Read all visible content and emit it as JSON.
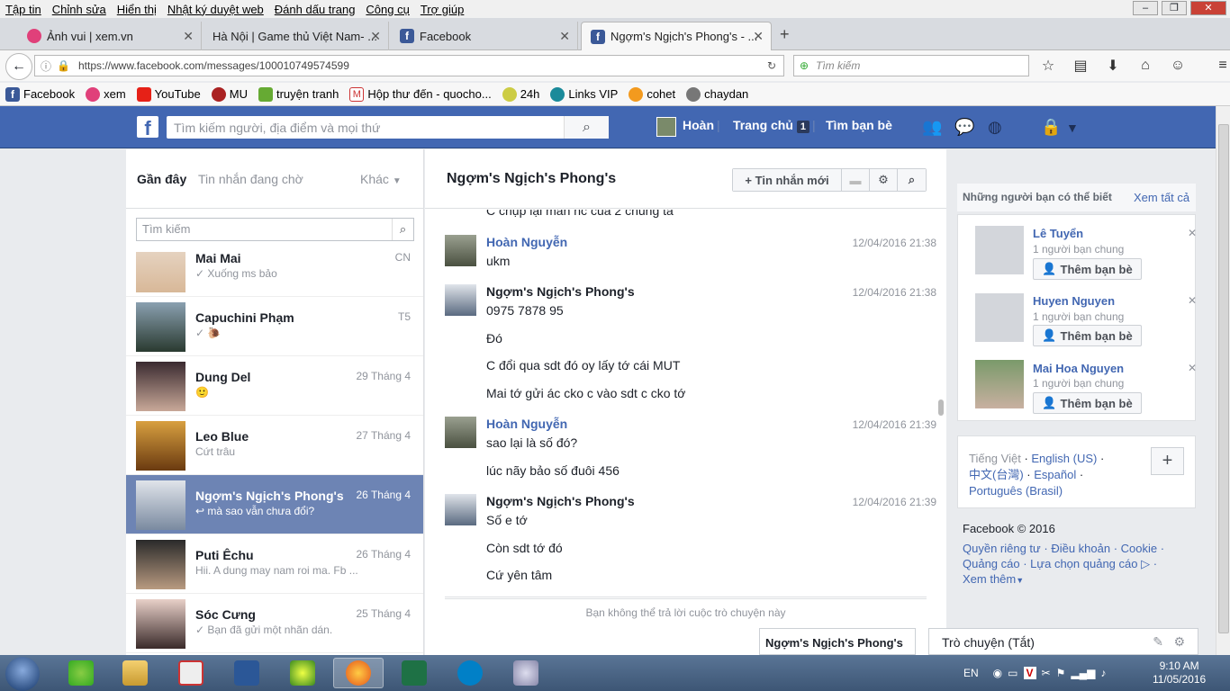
{
  "menu": [
    "Tập tin",
    "Chỉnh sửa",
    "Hiển thị",
    "Nhật ký duyệt web",
    "Đánh dấu trang",
    "Công cụ",
    "Trợ giúp"
  ],
  "tabs": [
    {
      "label": "Ảnh vui | xem.vn"
    },
    {
      "label": "Hà Nội | Game thủ Việt Nam- ..."
    },
    {
      "label": "Facebook"
    },
    {
      "label": "Ngợm's Ngịch's Phong's - ..."
    }
  ],
  "url": "https://www.facebook.com/messages/100010749574599",
  "url_host": "facebook.com",
  "browser_search_placeholder": "Tìm kiếm",
  "bookmarks": [
    "Facebook",
    "xem",
    "YouTube",
    "MU",
    "truyện tranh",
    "Hộp thư đến - quocho...",
    "24h",
    "Links VIP",
    "cohet",
    "chaydan"
  ],
  "fb": {
    "search_placeholder": "Tìm kiếm người, địa điểm và mọi thứ",
    "user": "Hoàn",
    "home": "Trang chủ",
    "home_badge": "1",
    "find_friends": "Tìm bạn bè"
  },
  "left": {
    "tab_recent": "Gần đây",
    "tab_pending": "Tin nhắn đang chờ",
    "tab_other": "Khác",
    "search_placeholder": "Tìm kiếm",
    "conversations": [
      {
        "name": "Mai Mai",
        "date": "CN",
        "preview": "✓ Xuống ms bảo"
      },
      {
        "name": "Capuchini Phạm",
        "date": "T5",
        "preview": "✓ 🐌"
      },
      {
        "name": "Dung Del",
        "date": "29 Tháng 4",
        "preview": "🙂"
      },
      {
        "name": "Leo Blue",
        "date": "27 Tháng 4",
        "preview": "Cứt trâu"
      },
      {
        "name": "Ngợm's Ngịch's Phong's",
        "date": "26 Tháng 4",
        "preview": "↩ mà sao vẫn chưa đổi?"
      },
      {
        "name": "Puti Êchu",
        "date": "26 Tháng 4",
        "preview": "Hii. A dung may nam roi ma. Fb ..."
      },
      {
        "name": "Sóc Cưng",
        "date": "25 Tháng 4",
        "preview": "✓ Bạn đã gửi một nhãn dán."
      }
    ]
  },
  "chat": {
    "title": "Ngợm's Ngịch's Phong's",
    "new_message": "+ Tin nhắn mới",
    "cut_line": "C chụp lại màn hc của 2 chúng tá",
    "blocks": [
      {
        "name": "Hoàn Nguyễn",
        "time": "12/04/2016 21:38",
        "lines": [
          "ukm"
        ]
      },
      {
        "name": "Ngợm's Ngịch's Phong's",
        "time": "12/04/2016 21:38",
        "lines": [
          "0975 7878 95",
          "Đó",
          "C đổi qua sdt đó oy lấy tớ cái MUT",
          "Mai tớ gửi ác cko c vào sdt c cko tớ"
        ]
      },
      {
        "name": "Hoàn Nguyễn",
        "time": "12/04/2016 21:39",
        "lines": [
          "sao lại là số đó?",
          "lúc nãy bảo số đuôi 456"
        ]
      },
      {
        "name": "Ngợm's Ngịch's Phong's",
        "time": "12/04/2016 21:39",
        "lines": [
          "Số e tớ",
          "Còn sdt tớ đó",
          "Cứ yên tâm"
        ]
      }
    ],
    "footer": "Bạn không thể trả lời cuộc trò chuyện này"
  },
  "right": {
    "title": "Những người bạn có thể biết",
    "see_all": "Xem tất cả",
    "suggestions": [
      {
        "name": "Lê Tuyển",
        "mutual": "1 người bạn chung",
        "btn": "Thêm bạn bè"
      },
      {
        "name": "Huyen Nguyen",
        "mutual": "1 người bạn chung",
        "btn": "Thêm bạn bè"
      },
      {
        "name": "Mai Hoa Nguyen",
        "mutual": "1 người bạn chung",
        "btn": "Thêm bạn bè"
      }
    ],
    "languages": [
      "Tiếng Việt",
      "English (US)",
      "中文(台灣)",
      "Español",
      "Português (Brasil)"
    ],
    "copyright": "Facebook © 2016",
    "footer_links": [
      "Quyền riêng tư",
      "Điều khoản",
      "Cookie",
      "Quảng cáo",
      "Lựa chọn quảng cáo",
      "Xem thêm"
    ]
  },
  "dock": {
    "chat_tab": "Ngợm's Ngịch's Phong's",
    "chat_status": "Trò chuyện (Tắt)"
  },
  "taskbar": {
    "lang": "EN",
    "time": "9:10 AM",
    "date": "11/05/2016"
  }
}
